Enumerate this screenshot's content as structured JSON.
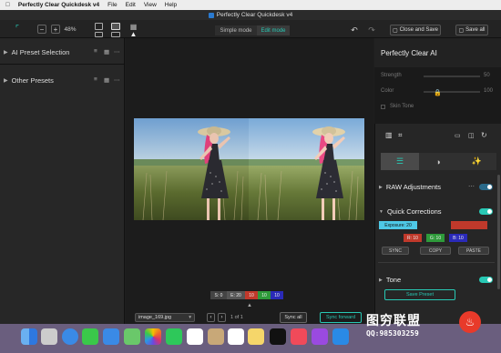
{
  "menubar": {
    "app": "Perfectly Clear Quickdesk v4",
    "items": [
      "File",
      "Edit",
      "View",
      "Help"
    ]
  },
  "window": {
    "title": "Perfectly Clear Quickdesk v4"
  },
  "toolbar": {
    "zoom": "48%",
    "minus": "−",
    "plus": "+",
    "simple_mode": "Simple mode",
    "edit_mode": "Edit mode",
    "close_save": "Close and Save",
    "save_all": "Save all"
  },
  "left": {
    "sections": [
      {
        "label": "AI Preset Selection"
      },
      {
        "label": "Other Presets"
      }
    ]
  },
  "right": {
    "title": "Perfectly Clear AI",
    "strength": "Strength",
    "strength_val": "50",
    "color": "Color",
    "color_val": "100",
    "skin_tone": "Skin Tone",
    "raw": "RAW Adjustments",
    "quick": "Quick Corrections",
    "exposure": "Exposure: 20",
    "r": "R: 10",
    "g": "G: 10",
    "b": "B: 10",
    "sync": "SYNC",
    "copy": "COPY",
    "paste": "PASTE",
    "tone": "Tone",
    "save_preset": "Save Preset"
  },
  "center": {
    "chips": [
      "S: 0",
      "E: 20",
      "10",
      "10",
      "10"
    ],
    "filename": "image_169.jpg",
    "pager": "1 of 1",
    "sync_all": "Sync all",
    "sync_forward": "Sync forward"
  },
  "watermark": {
    "line1": "图穷联盟",
    "line2": "QQ:985303259"
  },
  "colors": {
    "accent": "#28c8b4",
    "red": "#c0392b",
    "green": "#2e9a3a",
    "blue": "#2a2ab8"
  }
}
